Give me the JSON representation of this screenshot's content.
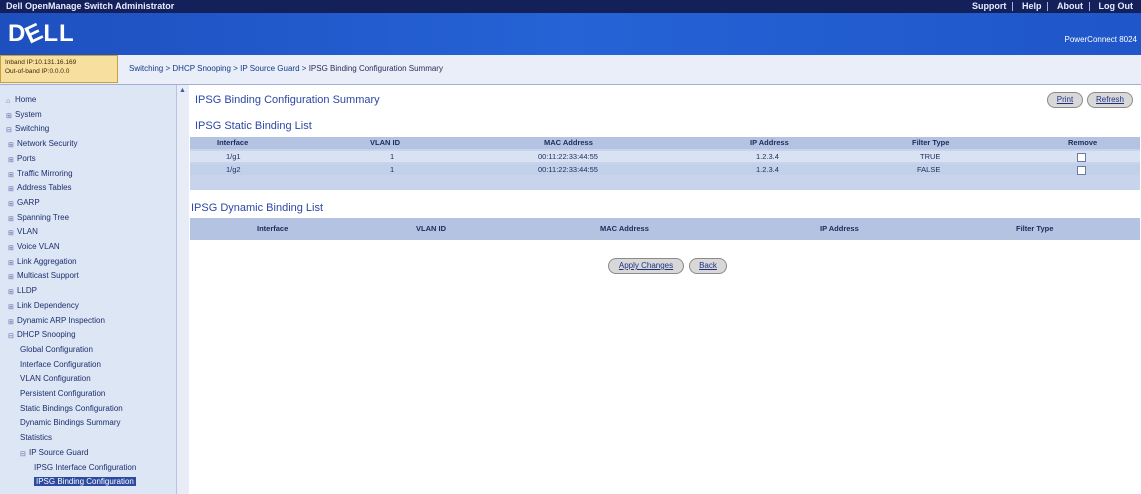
{
  "titlebar": {
    "title": "Dell OpenManage Switch Administrator",
    "links": [
      "Support",
      "Help",
      "About",
      "Log Out"
    ]
  },
  "banner": {
    "logo": "DELL",
    "product": "PowerConnect 8024"
  },
  "infobar": {
    "inband_ip": "Inband IP:10.131.16.169",
    "oob_ip": "Out-of-band IP:0.0.0.0",
    "breadcrumb": [
      "Switching",
      "DHCP Snooping",
      "IP Source Guard",
      "IPSG Binding Configuration Summary"
    ],
    "separator": ">"
  },
  "nav": {
    "items": [
      {
        "label": "Home",
        "level": 0,
        "icon": "home-icon"
      },
      {
        "label": "System",
        "level": 0,
        "icon": "plus"
      },
      {
        "label": "Switching",
        "level": 0,
        "icon": "minus"
      },
      {
        "label": "Network Security",
        "level": 1,
        "icon": "plus"
      },
      {
        "label": "Ports",
        "level": 1,
        "icon": "plus"
      },
      {
        "label": "Traffic Mirroring",
        "level": 1,
        "icon": "plus"
      },
      {
        "label": "Address Tables",
        "level": 1,
        "icon": "plus"
      },
      {
        "label": "GARP",
        "level": 1,
        "icon": "plus"
      },
      {
        "label": "Spanning Tree",
        "level": 1,
        "icon": "plus"
      },
      {
        "label": "VLAN",
        "level": 1,
        "icon": "plus"
      },
      {
        "label": "Voice VLAN",
        "level": 1,
        "icon": "plus"
      },
      {
        "label": "Link Aggregation",
        "level": 1,
        "icon": "plus"
      },
      {
        "label": "Multicast Support",
        "level": 1,
        "icon": "plus"
      },
      {
        "label": "LLDP",
        "level": 1,
        "icon": "plus"
      },
      {
        "label": "Link Dependency",
        "level": 1,
        "icon": "plus"
      },
      {
        "label": "Dynamic ARP Inspection",
        "level": 1,
        "icon": "plus"
      },
      {
        "label": "DHCP Snooping",
        "level": 1,
        "icon": "minus"
      },
      {
        "label": "Global Configuration",
        "level": 2,
        "icon": ""
      },
      {
        "label": "Interface Configuration",
        "level": 2,
        "icon": ""
      },
      {
        "label": "VLAN Configuration",
        "level": 2,
        "icon": ""
      },
      {
        "label": "Persistent Configuration",
        "level": 2,
        "icon": ""
      },
      {
        "label": "Static Bindings Configuration",
        "level": 2,
        "icon": ""
      },
      {
        "label": "Dynamic Bindings Summary",
        "level": 2,
        "icon": ""
      },
      {
        "label": "Statistics",
        "level": 2,
        "icon": ""
      },
      {
        "label": "IP Source Guard",
        "level": 2,
        "icon": "minus"
      },
      {
        "label": "IPSG Interface Configuration",
        "level": 3,
        "icon": ""
      },
      {
        "label": "IPSG Binding Configuration",
        "level": 3,
        "icon": "",
        "selected": true
      }
    ]
  },
  "main": {
    "title": "IPSG Binding Configuration Summary",
    "print_label": "Print",
    "refresh_label": "Refresh",
    "static_list": {
      "title": "IPSG Static Binding List",
      "columns": [
        "Interface",
        "VLAN ID",
        "MAC Address",
        "IP Address",
        "Filter Type",
        "Remove"
      ],
      "rows": [
        {
          "interface": "1/g1",
          "vlan": "1",
          "mac": "00:11:22:33:44:55",
          "ip": "1.2.3.4",
          "filter": "TRUE",
          "remove": false
        },
        {
          "interface": "1/g2",
          "vlan": "1",
          "mac": "00:11:22:33:44:55",
          "ip": "1.2.3.4",
          "filter": "FALSE",
          "remove": false
        }
      ]
    },
    "dynamic_list": {
      "title": "IPSG Dynamic Binding List",
      "columns": [
        "Interface",
        "VLAN ID",
        "MAC Address",
        "IP Address",
        "Filter Type"
      ]
    },
    "apply_label": "Apply Changes",
    "back_label": "Back"
  },
  "colors": {
    "titlebar": "#14205a",
    "banner": "#2563d6",
    "nav_bg": "#dde6f5",
    "table_header": "#b4c3e2",
    "heading": "#2b47a8"
  }
}
